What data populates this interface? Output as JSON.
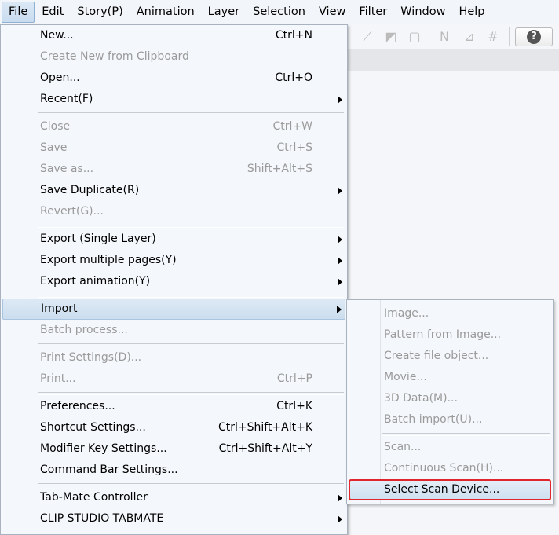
{
  "menubar": [
    "File",
    "Edit",
    "Story(P)",
    "Animation",
    "Layer",
    "Selection",
    "View",
    "Filter",
    "Window",
    "Help"
  ],
  "file_menu": [
    {
      "label": "New...",
      "shortcut": "Ctrl+N",
      "enabled": true
    },
    {
      "label": "Create New from Clipboard",
      "shortcut": "",
      "enabled": false
    },
    {
      "label": "Open...",
      "shortcut": "Ctrl+O",
      "enabled": true
    },
    {
      "label": "Recent(F)",
      "shortcut": "",
      "enabled": true,
      "submenu": true
    },
    {
      "sep": true
    },
    {
      "label": "Close",
      "shortcut": "Ctrl+W",
      "enabled": false
    },
    {
      "label": "Save",
      "shortcut": "Ctrl+S",
      "enabled": false
    },
    {
      "label": "Save as...",
      "shortcut": "Shift+Alt+S",
      "enabled": false
    },
    {
      "label": "Save Duplicate(R)",
      "shortcut": "",
      "enabled": true,
      "submenu": true
    },
    {
      "label": "Revert(G)...",
      "shortcut": "",
      "enabled": false
    },
    {
      "sep": true
    },
    {
      "label": "Export (Single Layer)",
      "shortcut": "",
      "enabled": true,
      "submenu": true
    },
    {
      "label": "Export multiple pages(Y)",
      "shortcut": "",
      "enabled": true,
      "submenu": true
    },
    {
      "label": "Export animation(Y)",
      "shortcut": "",
      "enabled": true,
      "submenu": true
    },
    {
      "sep": true
    },
    {
      "label": "Import",
      "shortcut": "",
      "enabled": true,
      "submenu": true,
      "highlighted": true
    },
    {
      "label": "Batch process...",
      "shortcut": "",
      "enabled": false
    },
    {
      "sep": true
    },
    {
      "label": "Print Settings(D)...",
      "shortcut": "",
      "enabled": false
    },
    {
      "label": "Print...",
      "shortcut": "Ctrl+P",
      "enabled": false
    },
    {
      "sep": true
    },
    {
      "label": "Preferences...",
      "shortcut": "Ctrl+K",
      "enabled": true
    },
    {
      "label": "Shortcut Settings...",
      "shortcut": "Ctrl+Shift+Alt+K",
      "enabled": true
    },
    {
      "label": "Modifier Key Settings...",
      "shortcut": "Ctrl+Shift+Alt+Y",
      "enabled": true
    },
    {
      "label": "Command Bar Settings...",
      "shortcut": "",
      "enabled": true
    },
    {
      "sep": true
    },
    {
      "label": "Tab-Mate Controller",
      "shortcut": "",
      "enabled": true,
      "submenu": true
    },
    {
      "label": "CLIP STUDIO TABMATE",
      "shortcut": "",
      "enabled": true,
      "submenu": true
    }
  ],
  "import_submenu": [
    {
      "label": "Image...",
      "enabled": false
    },
    {
      "label": "Pattern from Image...",
      "enabled": false
    },
    {
      "label": "Create file object...",
      "enabled": false
    },
    {
      "label": "Movie...",
      "enabled": false
    },
    {
      "label": "3D Data(M)...",
      "enabled": false
    },
    {
      "label": "Batch import(U)...",
      "enabled": false
    },
    {
      "sep": true
    },
    {
      "label": "Scan...",
      "enabled": false
    },
    {
      "label": "Continuous Scan(H)...",
      "enabled": false
    },
    {
      "label": "Select Scan Device...",
      "enabled": true,
      "selected": true
    }
  ],
  "toolbar": {
    "help_label": "?"
  }
}
